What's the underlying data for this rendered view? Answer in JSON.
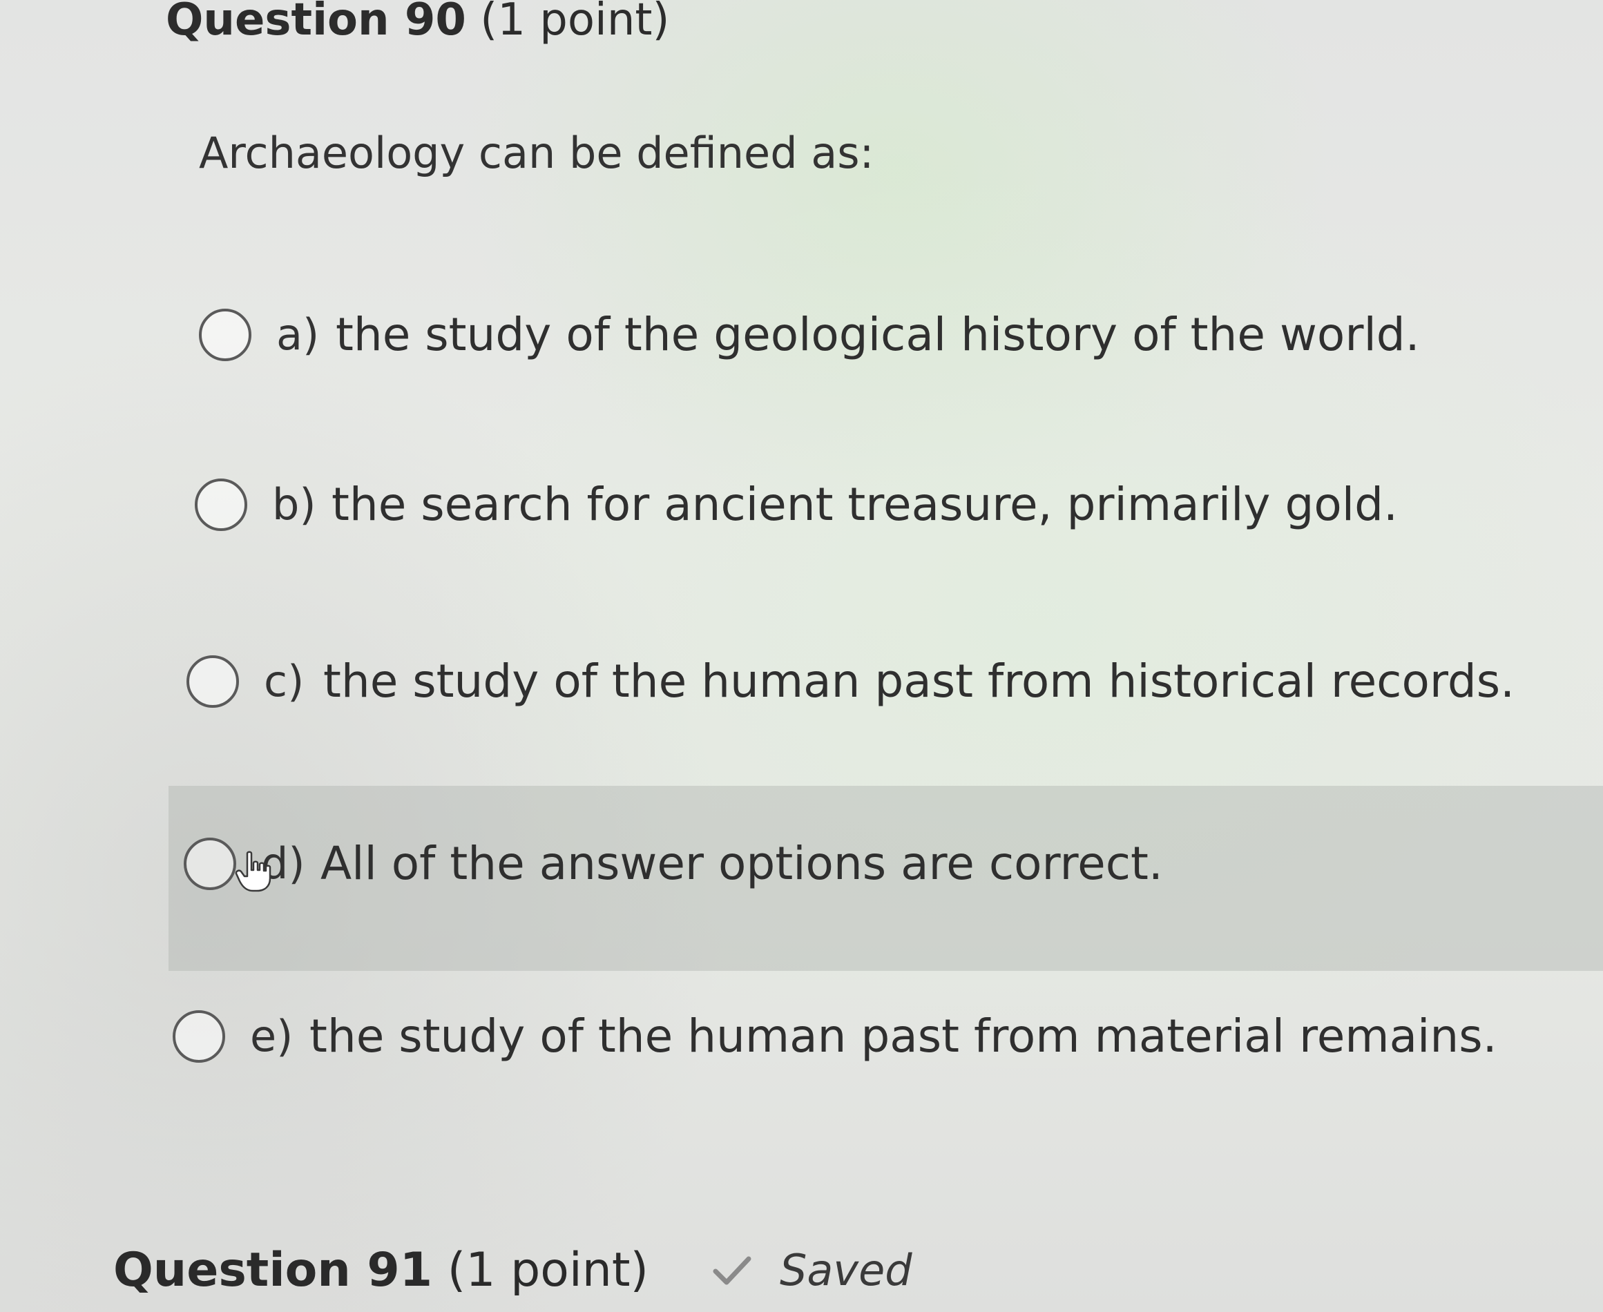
{
  "question": {
    "title": "Question 90",
    "points": "(1 point)",
    "prompt": "Archaeology can be defined as:"
  },
  "options": [
    {
      "letter": "a)",
      "text": "the study of the geological history of the world."
    },
    {
      "letter": "b)",
      "text": "the search for ancient treasure, primarily gold."
    },
    {
      "letter": "c)",
      "text": "the study of the human past from historical records."
    },
    {
      "letter": "d)",
      "text": "All of the answer options are correct."
    },
    {
      "letter": "e)",
      "text": "the study of the human past from material remains."
    }
  ],
  "next_question": {
    "title": "Question 91",
    "points": "(1 point)",
    "status": "Saved",
    "status_icon": "checkmark-icon"
  },
  "hovered_option": "d)",
  "colors": {
    "text": "#2f2f2f",
    "highlight": "#b0b2af",
    "radio_border": "#5a5a5a"
  }
}
